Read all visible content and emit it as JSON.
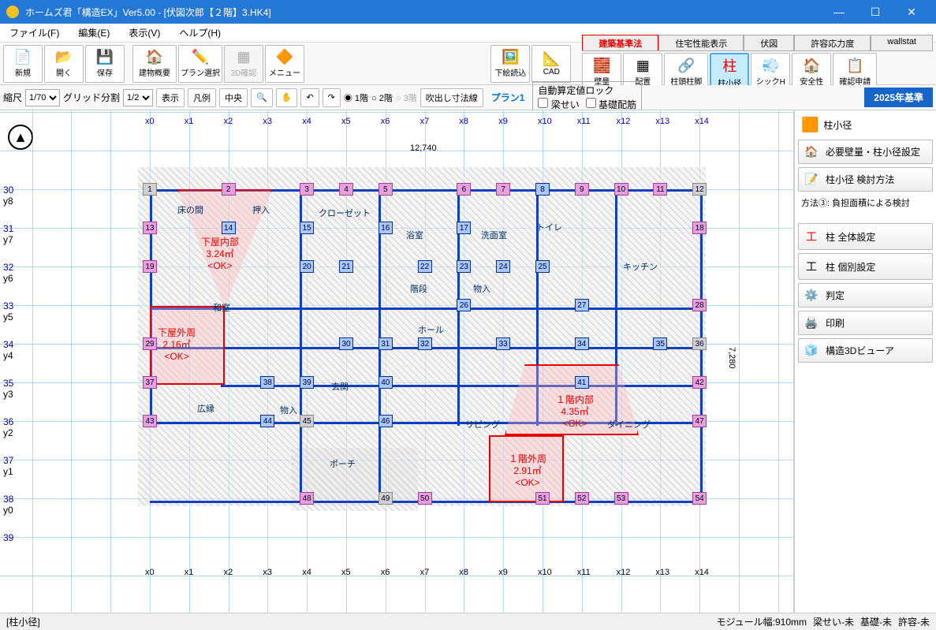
{
  "titlebar": {
    "text": "ホームズ君「構造EX」Ver5.00 - [伏図次郎【２階】3.HK4]"
  },
  "menu": {
    "file": "ファイル(F)",
    "edit": "編集(E)",
    "view": "表示(V)",
    "help": "ヘルプ(H)"
  },
  "toolbar1": {
    "new": "新規",
    "open": "開く",
    "save": "保存",
    "bldg": "建物概要",
    "plan": "プラン選択",
    "d3": "3D確認",
    "menu": "メニュー",
    "imgload": "下絵読込",
    "cad": "CAD",
    "wall": "壁量",
    "layout": "配置",
    "colhead": "柱頭柱脚",
    "colsize": "柱小径",
    "sickh": "シックH",
    "safety": "安全性",
    "confirm": "確認申請"
  },
  "tabs": {
    "law": "建築基準法",
    "perf": "住宅性能表示",
    "fusezu": "伏図",
    "allow": "許容応力度",
    "wallstat": "wallstat"
  },
  "toolbar2": {
    "scale_lbl": "縮尺",
    "scale": "1/70",
    "grid_lbl": "グリッド分割",
    "grid": "1/2",
    "show": "表示",
    "legend": "凡例",
    "center": "中央",
    "f1": "◉ 1階",
    "f2": "○ 2階",
    "f3": "○ 3階",
    "blow": "吹出し寸法線",
    "plan": "プラン1",
    "auto_title": "自動算定値ロック",
    "auto1": "梁せい",
    "auto2": "基礎配筋",
    "year": "2025年基準"
  },
  "sidebar": {
    "head": "柱小径",
    "req": "必要壁量・柱小径設定",
    "method": "柱小径 検討方法",
    "method_note": "方法③: 負担面積による検討",
    "allcol": "柱 全体設定",
    "indcol": "柱 個別設定",
    "judge": "判定",
    "print": "印刷",
    "viewer": "構造3Dビューア"
  },
  "status": {
    "mode": "[柱小径]",
    "module": "モジュール幅:910mm",
    "s2": "梁せい-未",
    "s3": "基礎-未",
    "s4": "許容-未"
  },
  "canvas": {
    "dim_w": "12,740",
    "dim_h": "7,280",
    "xlabels": [
      "x0",
      "x1",
      "x2",
      "x3",
      "x4",
      "x5",
      "x6",
      "x7",
      "x8",
      "x9",
      "x10",
      "x11",
      "x12",
      "x13",
      "x14"
    ],
    "ylabels": [
      {
        "n": "30",
        "t": "y8"
      },
      {
        "n": "31",
        "t": "y7"
      },
      {
        "n": "32",
        "t": "y6"
      },
      {
        "n": "33",
        "t": "y5"
      },
      {
        "n": "34",
        "t": "y4"
      },
      {
        "n": "35",
        "t": "y3"
      },
      {
        "n": "36",
        "t": "y2"
      },
      {
        "n": "37",
        "t": "y1"
      },
      {
        "n": "38",
        "t": "y0"
      },
      {
        "n": "39",
        "t": ""
      }
    ],
    "rooms": [
      "床の間",
      "押入",
      "クローゼット",
      "浴室",
      "洗面室",
      "トイレ",
      "和室",
      "階段",
      "物入",
      "キッチン",
      "ホール",
      "玄関",
      "広縁",
      "物入",
      "リビング",
      "ダイニング",
      "ポーチ"
    ],
    "zones": [
      {
        "title": "下屋内部",
        "area": "3.24㎡",
        "ok": "<OK>"
      },
      {
        "title": "下屋外周",
        "area": "2.16㎡",
        "ok": "<OK>"
      },
      {
        "title": "１階内部",
        "area": "4.35㎡",
        "ok": "<OK>"
      },
      {
        "title": "１階外周",
        "area": "2.91㎡",
        "ok": "<OK>"
      }
    ]
  }
}
